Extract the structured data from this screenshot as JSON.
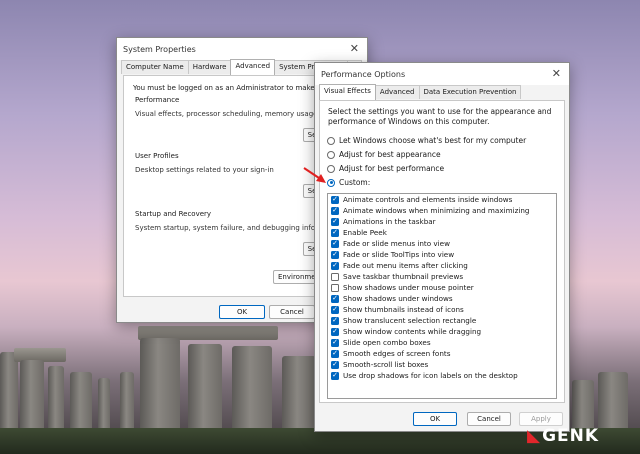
{
  "system_properties": {
    "title": "System Properties",
    "tabs": [
      "Computer Name",
      "Hardware",
      "Advanced",
      "System Protection",
      "R"
    ],
    "admin_note": "You must be logged on as an Administrator to make most of the",
    "performance": {
      "label": "Performance",
      "desc": "Visual effects, processor scheduling, memory usage, and virtua",
      "button": "Se"
    },
    "user_profiles": {
      "label": "User Profiles",
      "desc": "Desktop settings related to your sign-in",
      "button": "Se"
    },
    "startup": {
      "label": "Startup and Recovery",
      "desc": "System startup, system failure, and debugging information",
      "button": "Se"
    },
    "environment_button": "Environme",
    "ok": "OK",
    "cancel": "Cancel"
  },
  "performance_options": {
    "title": "Performance Options",
    "tabs": [
      "Visual Effects",
      "Advanced",
      "Data Execution Prevention"
    ],
    "intro_line1": "Select the settings you want to use for the appearance and",
    "intro_line2": "performance of Windows on this computer.",
    "radios": [
      {
        "label": "Let Windows choose what's best for my computer",
        "selected": false
      },
      {
        "label": "Adjust for best appearance",
        "selected": false
      },
      {
        "label": "Adjust for best performance",
        "selected": false
      },
      {
        "label": "Custom:",
        "selected": true
      }
    ],
    "options": [
      {
        "label": "Animate controls and elements inside windows",
        "checked": true
      },
      {
        "label": "Animate windows when minimizing and maximizing",
        "checked": true
      },
      {
        "label": "Animations in the taskbar",
        "checked": true
      },
      {
        "label": "Enable Peek",
        "checked": true
      },
      {
        "label": "Fade or slide menus into view",
        "checked": true
      },
      {
        "label": "Fade or slide ToolTips into view",
        "checked": true
      },
      {
        "label": "Fade out menu items after clicking",
        "checked": true
      },
      {
        "label": "Save taskbar thumbnail previews",
        "checked": false
      },
      {
        "label": "Show shadows under mouse pointer",
        "checked": false
      },
      {
        "label": "Show shadows under windows",
        "checked": true
      },
      {
        "label": "Show thumbnails instead of icons",
        "checked": true
      },
      {
        "label": "Show translucent selection rectangle",
        "checked": true
      },
      {
        "label": "Show window contents while dragging",
        "checked": true
      },
      {
        "label": "Slide open combo boxes",
        "checked": true
      },
      {
        "label": "Smooth edges of screen fonts",
        "checked": true
      },
      {
        "label": "Smooth-scroll list boxes",
        "checked": true
      },
      {
        "label": "Use drop shadows for icon labels on the desktop",
        "checked": true
      }
    ],
    "ok": "OK",
    "cancel": "Cancel",
    "apply": "Apply"
  },
  "watermark": "GENK",
  "colors": {
    "accent": "#0067c0",
    "arrow": "#e02020",
    "logo_red": "#e2262b"
  }
}
